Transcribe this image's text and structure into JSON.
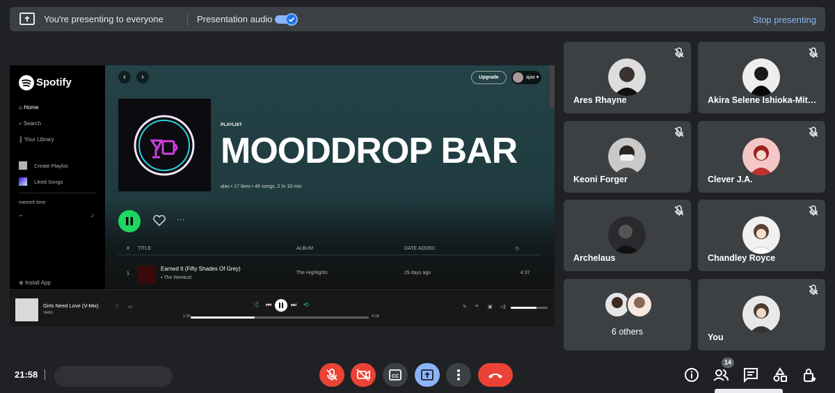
{
  "banner": {
    "presenting_text": "You're presenting to everyone",
    "audio_label": "Presentation audio",
    "stop_label": "Stop presenting"
  },
  "spotify": {
    "logo": "Spotify",
    "nav": [
      "Home",
      "Search",
      "Your Library"
    ],
    "create_playlist": "Create Playlist",
    "liked_songs": "Liked Songs",
    "playlist_item": "memeh time",
    "install": "Install App",
    "upgrade": "Upgrade",
    "user": "ajax",
    "type_label": "PLAYLIST",
    "title": "MOODDROP BAR",
    "meta": "alas • 17 likes • 46 songs, 2 hr 33 min",
    "columns": {
      "num": "#",
      "title": "TITLE",
      "album": "ALBUM",
      "date": "DATE ADDED"
    },
    "track": {
      "num": "1",
      "title": "Earned It (Fifty Shades Of Grey)",
      "artist": "The Weeknd",
      "album": "The Highlights",
      "date": "29 days ago",
      "duration": "4:37"
    },
    "now_playing": {
      "title": "Girls Need Love (V-Mix)",
      "artist": "Vedo",
      "elapsed": "1:30",
      "total": "4:18",
      "progress": 0.36,
      "volume": 0.7
    }
  },
  "participants": [
    {
      "name": "Ares Rhayne",
      "muted": true
    },
    {
      "name": "Akira Selene Ishioka-Mit…",
      "muted": true
    },
    {
      "name": "Keoni Forger",
      "muted": true
    },
    {
      "name": "Clever J.A.",
      "muted": true
    },
    {
      "name": "Archelaus",
      "muted": true
    },
    {
      "name": "Chandley Royce",
      "muted": true
    },
    {
      "name": "6 others",
      "muted": false
    },
    {
      "name": "You",
      "muted": true
    }
  ],
  "bottom": {
    "time": "21:58",
    "participant_count": "14"
  },
  "colors": {
    "accent_blue": "#8ab4f8",
    "red": "#ea4335",
    "spotify_green": "#1ed760"
  }
}
